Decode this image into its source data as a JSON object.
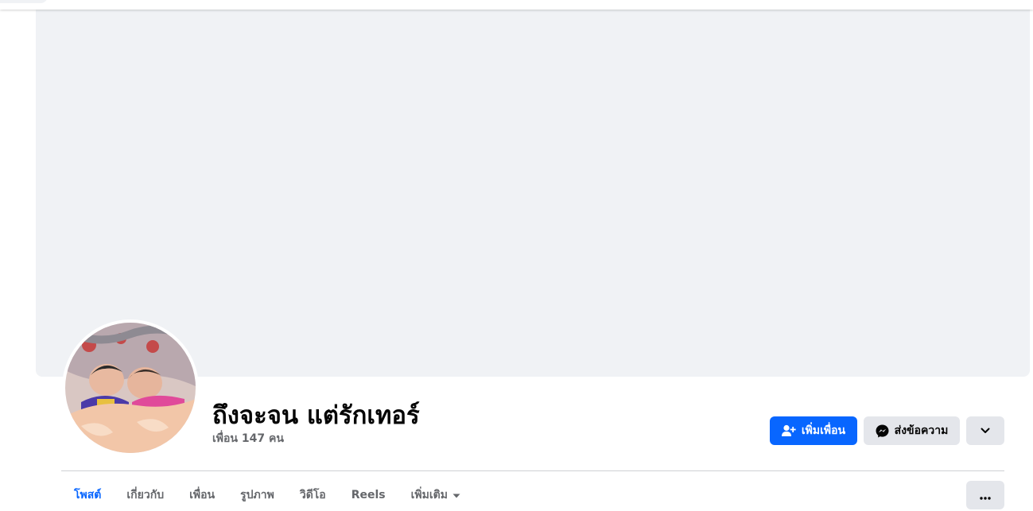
{
  "profile": {
    "name": "ถึงจะจน แต่รักเทอร์",
    "friends_text": "เพื่อน 147 คน"
  },
  "actions": {
    "add_friend": {
      "label": "เพิ่มเพื่อน",
      "icon": "add-friend-icon"
    },
    "message": {
      "label": "ส่งข้อความ",
      "icon": "messenger-icon"
    },
    "dropdown": {
      "icon": "chevron-down-icon"
    }
  },
  "tabs": [
    {
      "label": "โพสต์",
      "active": true
    },
    {
      "label": "เกี่ยวกับ",
      "active": false
    },
    {
      "label": "เพื่อน",
      "active": false
    },
    {
      "label": "รูปภาพ",
      "active": false
    },
    {
      "label": "วิดีโอ",
      "active": false
    },
    {
      "label": "Reels",
      "active": false
    },
    {
      "label": "เพิ่มเติม",
      "active": false,
      "icon": "caret-down-icon"
    }
  ],
  "more_options_icon": "ellipsis-icon",
  "colors": {
    "accent": "#0866ff",
    "cover_bg": "#f0f2f5",
    "secondary_button": "#e4e6eb",
    "muted_text": "#65676b"
  }
}
